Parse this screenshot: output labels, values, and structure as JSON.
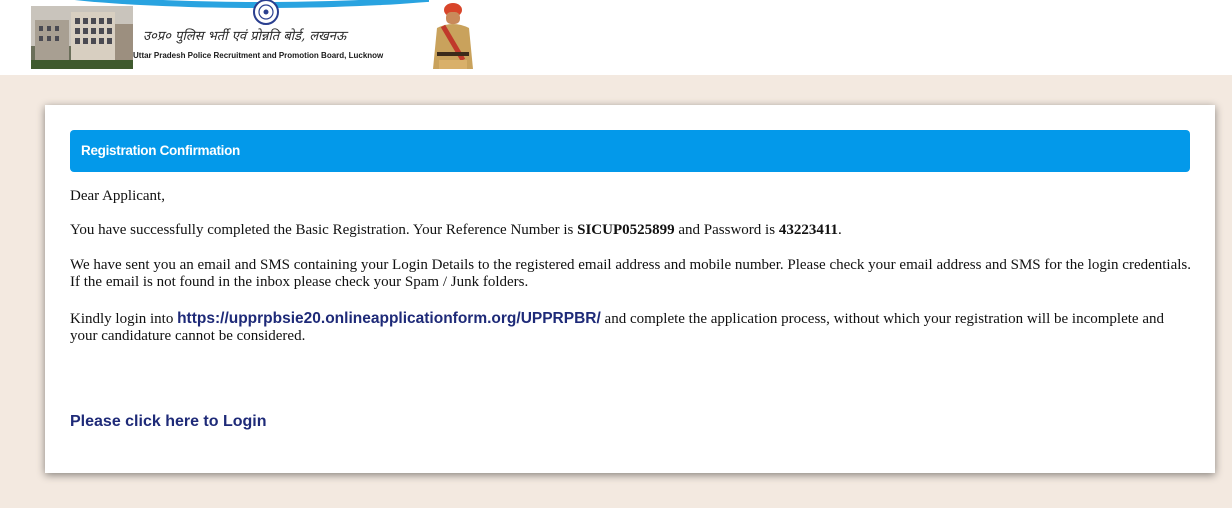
{
  "header": {
    "hindi_title": "उ०प्र० पुलिस भर्ती एवं प्रोन्नति बोर्ड, लखनऊ",
    "english_title": "Uttar Pradesh Police Recruitment and Promotion Board, Lucknow"
  },
  "card": {
    "heading": "Registration Confirmation",
    "greeting": "Dear Applicant,",
    "confirmation_prefix": "You have successfully completed the Basic Registration. Your Reference Number is ",
    "reference_number": "SICUP0525899",
    "password_prefix": " and Password is ",
    "password": "43223411",
    "confirmation_suffix": ".",
    "email_notice": "We have sent you an email and SMS containing your Login Details to the registered email address and mobile number. Please check your email address and SMS for the login credentials. If the email is not found in the inbox please check your Spam / Junk folders.",
    "login_prefix": "Kindly login into ",
    "login_url": "https://upprpbsie20.onlineapplicationform.org/UPPRPBR/",
    "login_suffix": " and complete the application process, without which your registration will be incomplete and your candidature cannot be considered.",
    "login_link_label": "Please click here to Login"
  },
  "colors": {
    "page_background": "#f3e9e0",
    "heading_bar": "#0399ea",
    "link": "#1e2a78",
    "banner_arc": "#29a3e0"
  },
  "icons": {
    "emblem": "upprpb-emblem-icon",
    "building": "headquarters-building-image",
    "officer": "police-officer-image"
  }
}
